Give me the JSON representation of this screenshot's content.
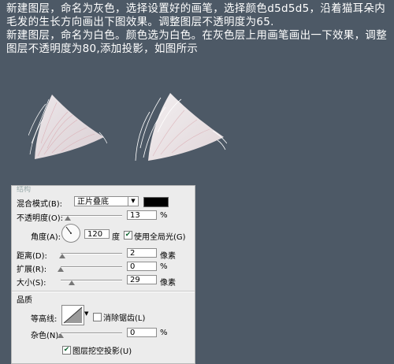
{
  "instructions": {
    "para1": "新建图层，命名为灰色，选择设置好的画笔，选择颜色d5d5d5，沿着猫耳朵内毛发的生长方向画出下图效果。调整图层不透明度为65.",
    "para2": "新建图层，命名为白色。颜色选为白色。在灰色层上用画笔画出一下效果，调整图层不透明度为80,添加投影，如图所示"
  },
  "dialog": {
    "group_title": "结构",
    "blend_mode_label": "混合模式(B):",
    "blend_mode_value": "正片叠底",
    "opacity_label": "不透明度(O):",
    "opacity_value": "13",
    "opacity_unit": "%",
    "angle_label": "角度(A):",
    "angle_value": "120",
    "angle_unit": "度",
    "global_light_label": "使用全局光(G)",
    "global_light_checked": true,
    "distance_label": "距离(D):",
    "distance_value": "2",
    "distance_unit": "像素",
    "spread_label": "扩展(R):",
    "spread_value": "0",
    "spread_unit": "%",
    "size_label": "大小(S):",
    "size_value": "29",
    "size_unit": "像素",
    "quality_title": "品质",
    "contour_label": "等高线:",
    "antialias_label": "消除锯齿(L)",
    "noise_label": "杂色(N):",
    "noise_value": "0",
    "noise_unit": "%",
    "knockout_label": "图层挖空投影(U)"
  },
  "colors": {
    "background": "#4d5966",
    "shadow_color": "#000000"
  }
}
